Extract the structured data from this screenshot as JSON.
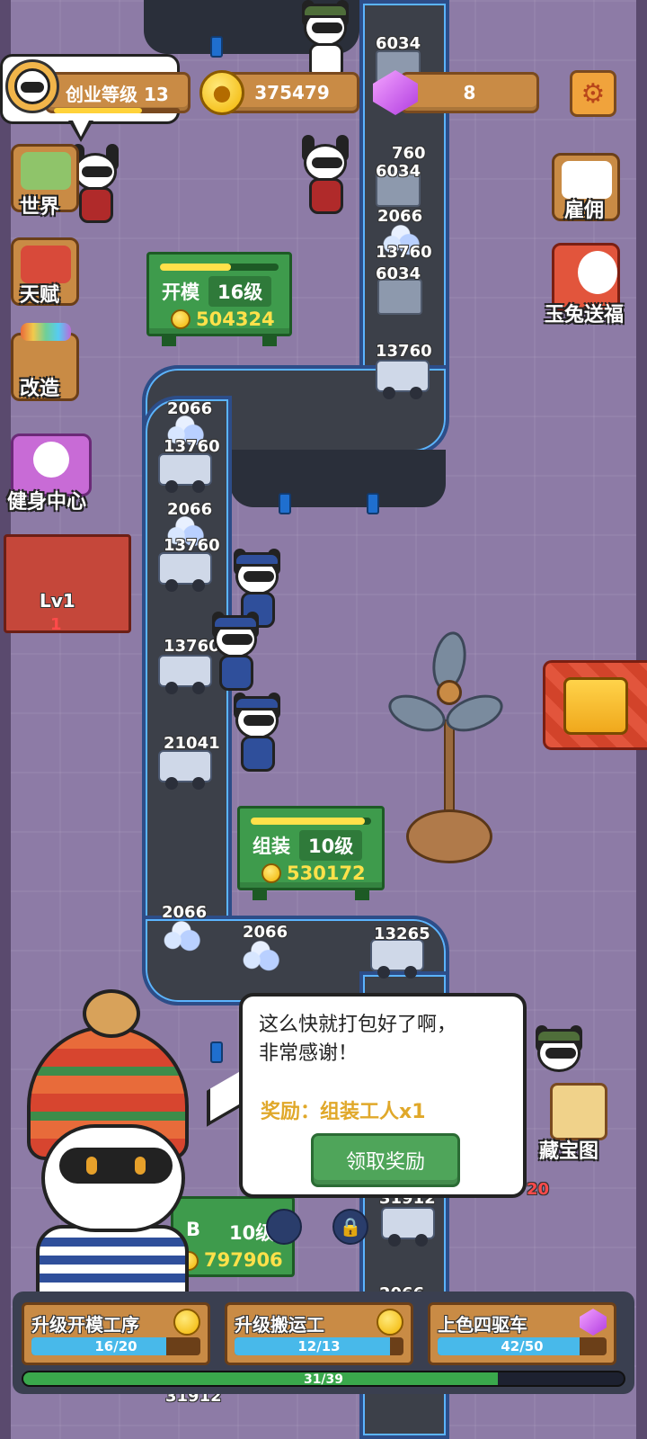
{
  "top": {
    "level_label": "创业等级 13",
    "level_progress": 0.7,
    "coins": "375479",
    "gems": "8"
  },
  "side_left": {
    "world": "世界",
    "talent": "天赋",
    "remodel": "改造",
    "gym": "健身中心"
  },
  "side_right": {
    "hire": "雇佣",
    "jade_rabbit": "玉兔送福",
    "treasure_map": "藏宝图"
  },
  "stations": {
    "mold": {
      "name": "开模",
      "level": "16级",
      "cost": "504324",
      "progress": 0.6
    },
    "assembly": {
      "name": "组装",
      "level": "10级",
      "cost": "530172",
      "progress": 0.95
    },
    "painting": {
      "name_partial": "B",
      "level_partial": "10级",
      "cost": "797906"
    }
  },
  "booth": {
    "level": "Lv1",
    "count": "1"
  },
  "items": {
    "n1": "6034",
    "n2": "760",
    "n3": "6034",
    "n4": "2066",
    "n5": "13760",
    "n6": "6034",
    "n7": "13760",
    "n8": "2066",
    "n9": "13760",
    "n10": "2066",
    "n11": "13760",
    "n12": "13760",
    "n13": "21041",
    "n14": "2066",
    "n15": "2066",
    "n16": "13265",
    "n17": "31912",
    "n18": "2066",
    "n19": "31912",
    "n20": "20"
  },
  "dialog": {
    "line1": "这么快就打包好了啊，",
    "line2": "非常感谢！",
    "reward": "奖励：组装工人x1",
    "claim": "领取奖励"
  },
  "upgrades": [
    {
      "label": "升级开模工序",
      "progress_text": "16/20",
      "progress": 0.8,
      "currency": "coin"
    },
    {
      "label": "升级搬运工",
      "progress_text": "12/13",
      "progress": 0.92,
      "currency": "coin"
    },
    {
      "label": "上色四驱车",
      "progress_text": "42/50",
      "progress": 0.84,
      "currency": "gem"
    }
  ],
  "total": {
    "text": "31/39",
    "progress": 0.79
  },
  "colors": {
    "belt_glow": "#5bb4ff",
    "station_green": "#3e9b4c",
    "wood": "#c98b45",
    "background": "#8d7ba6"
  }
}
